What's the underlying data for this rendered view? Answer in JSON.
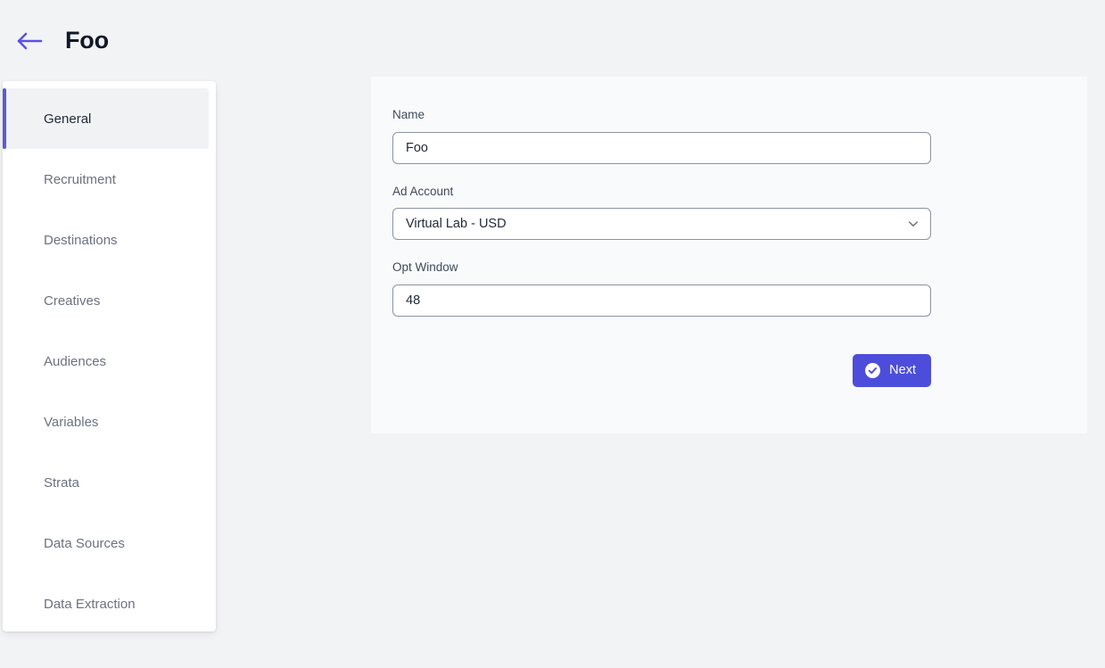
{
  "header": {
    "back_icon": "arrow-left-icon",
    "title": "Foo"
  },
  "sidebar": {
    "items": [
      {
        "label": "General",
        "active": true
      },
      {
        "label": "Recruitment",
        "active": false
      },
      {
        "label": "Destinations",
        "active": false
      },
      {
        "label": "Creatives",
        "active": false
      },
      {
        "label": "Audiences",
        "active": false
      },
      {
        "label": "Variables",
        "active": false
      },
      {
        "label": "Strata",
        "active": false
      },
      {
        "label": "Data Sources",
        "active": false
      },
      {
        "label": "Data Extraction",
        "active": false
      }
    ]
  },
  "form": {
    "name": {
      "label": "Name",
      "value": "Foo",
      "placeholder": ""
    },
    "ad_account": {
      "label": "Ad Account",
      "value": "Virtual Lab - USD",
      "chevron_icon": "chevron-down-icon",
      "options": [
        "Virtual Lab - USD"
      ]
    },
    "opt_window": {
      "label": "Opt Window",
      "value": "48",
      "placeholder": ""
    },
    "next_button": {
      "label": "Next",
      "icon": "check-circle-icon"
    }
  },
  "colors": {
    "accent": "#4d4ddb",
    "accent_bar": "#5b5bd6",
    "page_background": "#f2f3f5",
    "card_background": "#f9fafb",
    "sidebar_background": "#ffffff",
    "active_item_background": "#f1f2f4",
    "input_border": "#8a93a3",
    "label_text": "#3f4a5a",
    "muted_text": "#6b7280",
    "title_text": "#111827"
  }
}
